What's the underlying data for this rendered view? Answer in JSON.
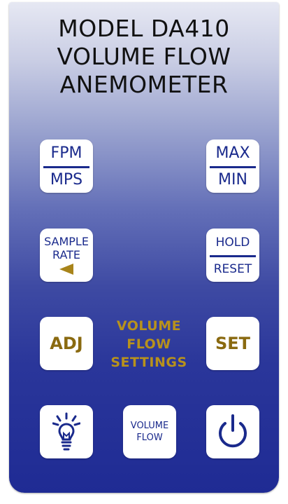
{
  "header": {
    "line1": "MODEL  DA410",
    "line2": "VOLUME FLOW",
    "line3": "ANEMOMETER"
  },
  "buttons": {
    "fpm_mps": {
      "top": "FPM",
      "bottom": "MPS"
    },
    "max_min": {
      "top": "MAX",
      "bottom": "MIN"
    },
    "sample_rate": {
      "line1": "SAMPLE",
      "line2": "RATE"
    },
    "hold_reset": {
      "top": "HOLD",
      "bottom": "RESET"
    },
    "adj": "ADJ",
    "set": "SET",
    "volume_flow": {
      "line1": "VOLUME",
      "line2": "FLOW"
    }
  },
  "center_label": {
    "line1": "VOLUME",
    "line2": "FLOW",
    "line3": "SETTINGS"
  },
  "icons": {
    "sample_rate_arrow": "left-arrow-icon",
    "light": "light-bulb-icon",
    "power": "power-icon"
  },
  "colors": {
    "button_text": "#1a2a8c",
    "accent_gold": "#b8921c",
    "panel_top": "#e6e8f3",
    "panel_bottom": "#1f2b94"
  }
}
